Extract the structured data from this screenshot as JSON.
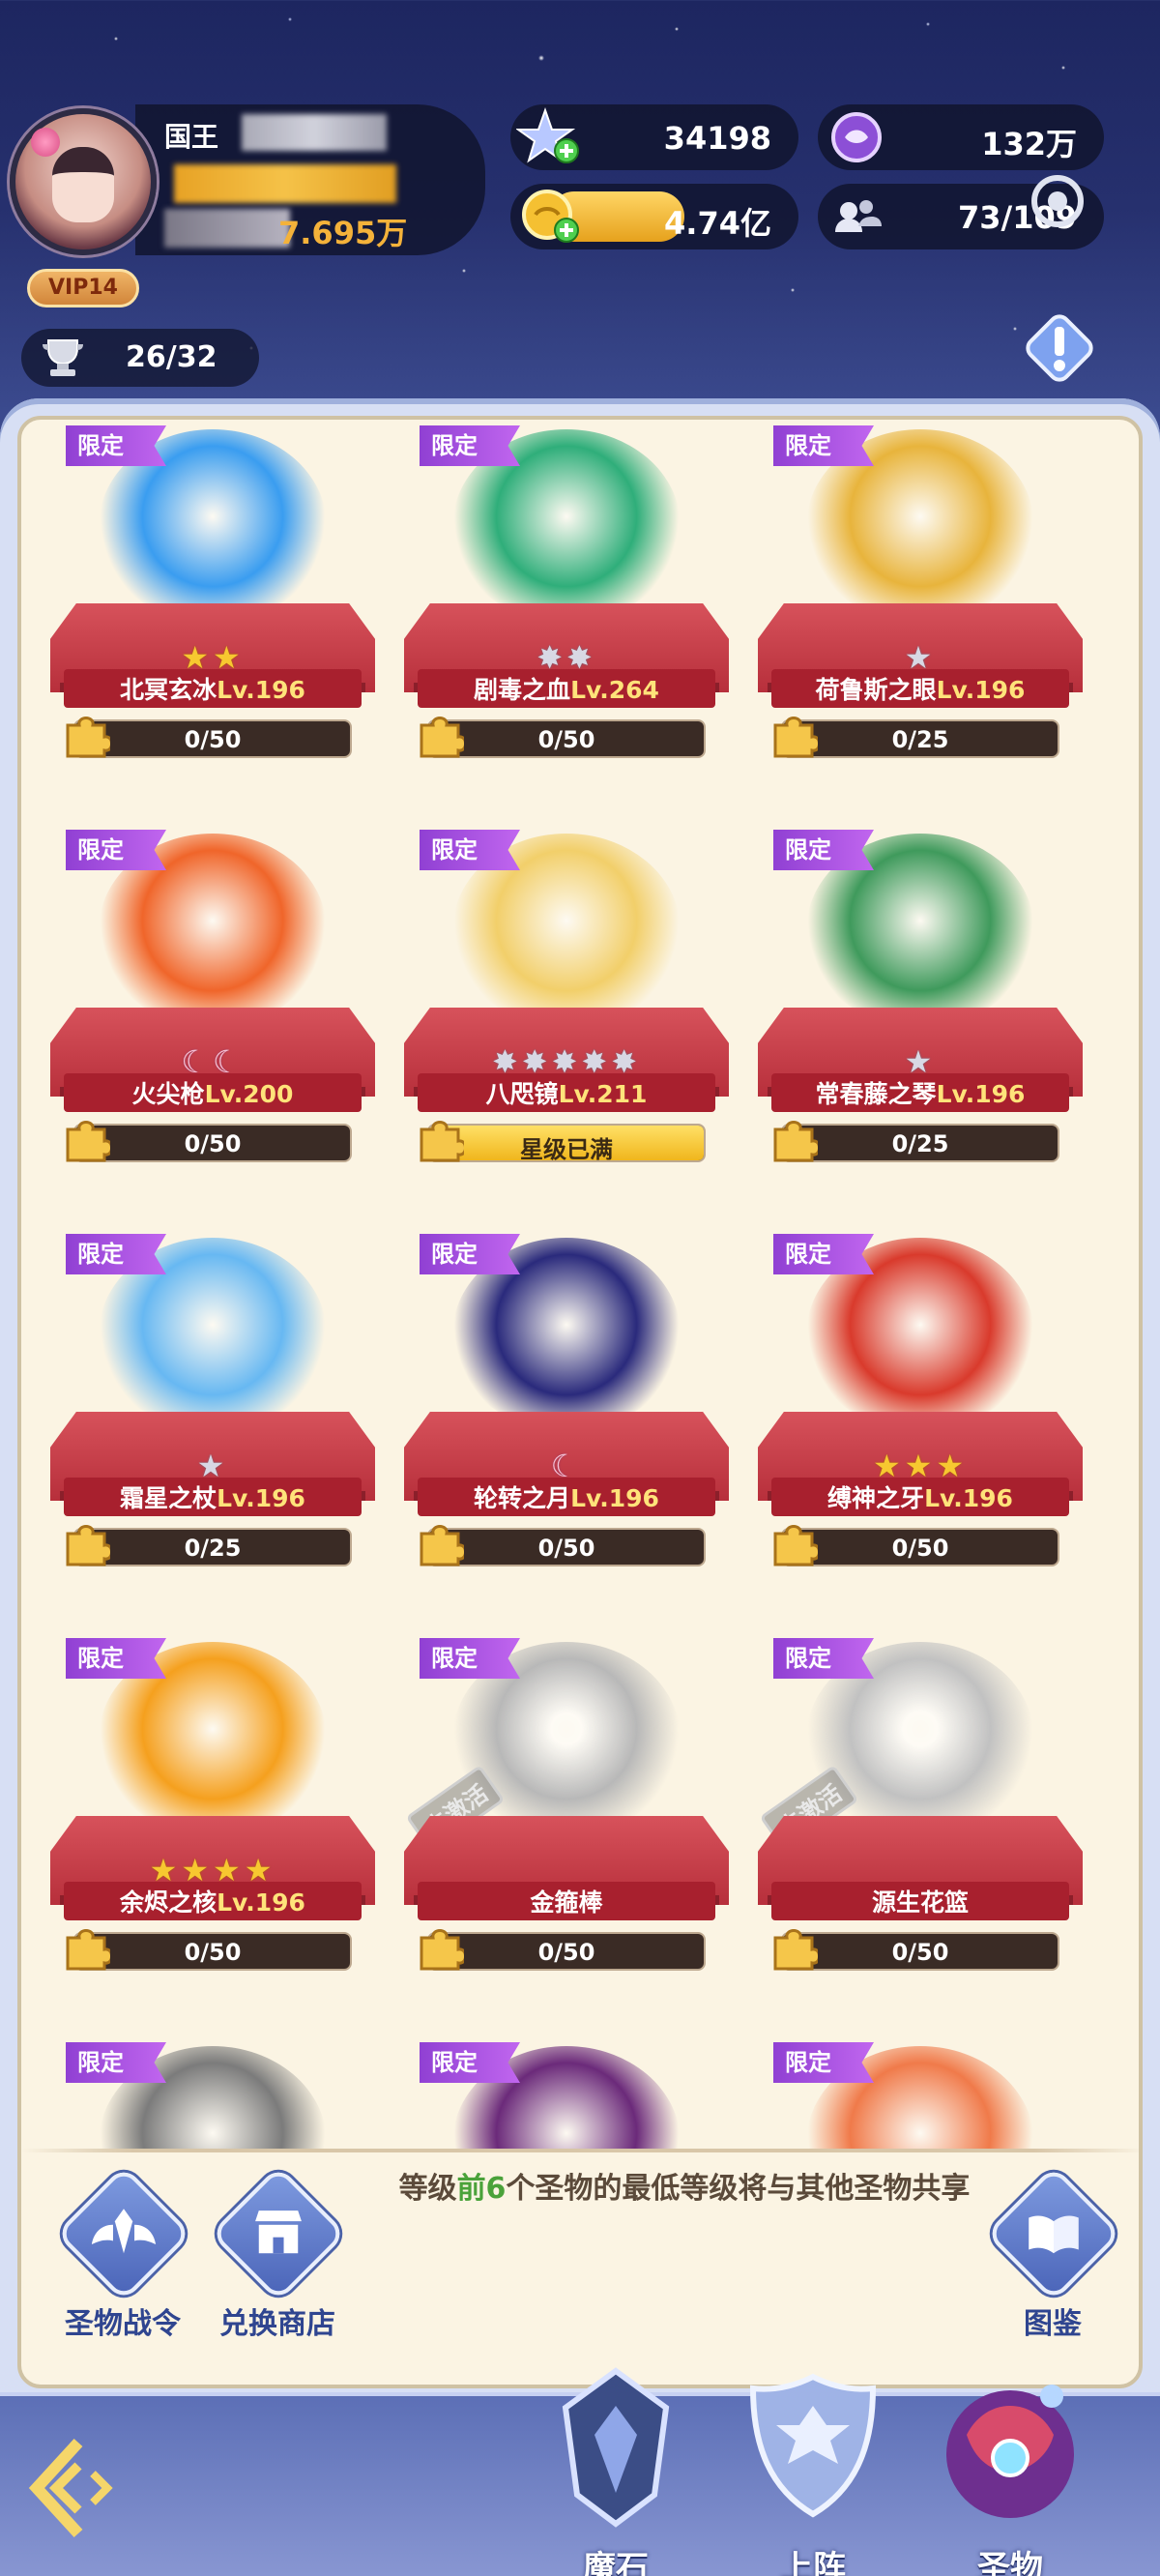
{
  "header": {
    "player_name": "国王",
    "power": "7.695万",
    "vip": "VIP14",
    "collection": "26/32",
    "resources": {
      "crystal": "34198",
      "purple_currency": "132万",
      "gold": "4.74亿",
      "guild": "73/109"
    }
  },
  "cards": [
    {
      "tag": "限定",
      "name": "北冥玄冰",
      "level": "Lv.196",
      "stars": "★★",
      "star_type": "gold",
      "progress": "0/50",
      "progress_value": 0.0,
      "color": "#3a9df0"
    },
    {
      "tag": "限定",
      "name": "剧毒之血",
      "level": "Lv.264",
      "stars": "✸✸",
      "star_type": "silver",
      "progress": "0/50",
      "progress_value": 0.0,
      "color": "#2fae7a"
    },
    {
      "tag": "限定",
      "name": "荷鲁斯之眼",
      "level": "Lv.196",
      "stars": "★",
      "star_type": "silver",
      "progress": "0/25",
      "progress_value": 0.0,
      "color": "#e8b43c"
    },
    {
      "tag": "限定",
      "name": "火尖枪",
      "level": "Lv.200",
      "stars": "☾☾",
      "star_type": "moon",
      "progress": "0/50",
      "progress_value": 0.0,
      "color": "#f0652a"
    },
    {
      "tag": "限定",
      "name": "八咫镜",
      "level": "Lv.211",
      "stars": "✸✸✸✸✸",
      "star_type": "silver",
      "progress": "星级已满",
      "progress_value": 1.0,
      "color": "#f2cf6a"
    },
    {
      "tag": "限定",
      "name": "常春藤之琴",
      "level": "Lv.196",
      "stars": "★",
      "star_type": "silver",
      "progress": "0/25",
      "progress_value": 0.0,
      "color": "#3f9a5c"
    },
    {
      "tag": "限定",
      "name": "霜星之杖",
      "level": "Lv.196",
      "stars": "★",
      "star_type": "silver",
      "progress": "0/25",
      "progress_value": 0.0,
      "color": "#67b8f2"
    },
    {
      "tag": "限定",
      "name": "轮转之月",
      "level": "Lv.196",
      "stars": "☾",
      "star_type": "moon",
      "progress": "0/50",
      "progress_value": 0.0,
      "color": "#2a2a7c"
    },
    {
      "tag": "限定",
      "name": "缚神之牙",
      "level": "Lv.196",
      "stars": "★★★",
      "star_type": "gold",
      "progress": "0/50",
      "progress_value": 0.0,
      "color": "#d93a2c"
    },
    {
      "tag": "限定",
      "name": "余烬之核",
      "level": "Lv.196",
      "stars": "★★★★",
      "star_type": "gold",
      "progress": "0/50",
      "progress_value": 0.0,
      "color": "#f5a01e"
    },
    {
      "tag": "限定",
      "name": "金箍棒",
      "level": "",
      "stars": "",
      "star_type": "gold",
      "progress": "0/50",
      "progress_value": 0.0,
      "color": "#a0a0a0",
      "inactive": "未激活"
    },
    {
      "tag": "限定",
      "name": "源生花篮",
      "level": "",
      "stars": "",
      "star_type": "gold",
      "progress": "0/50",
      "progress_value": 0.0,
      "color": "#a8a8a8",
      "inactive": "未激活"
    },
    {
      "tag": "限定",
      "name": "",
      "level": "",
      "stars": "",
      "star_type": "gold",
      "progress": "",
      "progress_value": 0.0,
      "color": "#7b7b7b"
    },
    {
      "tag": "限定",
      "name": "",
      "level": "",
      "stars": "",
      "star_type": "gold",
      "progress": "",
      "progress_value": 0.0,
      "color": "#6b2a7a"
    },
    {
      "tag": "限定",
      "name": "",
      "level": "",
      "stars": "",
      "star_type": "gold",
      "progress": "",
      "progress_value": 0.0,
      "color": "#f07a4a"
    }
  ],
  "footer": {
    "battle_pass": "圣物战令",
    "exchange_shop": "兑换商店",
    "tip_prefix": "等级",
    "tip_highlight": "前6",
    "tip_suffix": "个圣物的最低等级将与其他圣物共享",
    "codex": "图鉴"
  },
  "nav": {
    "tab1": "魔石",
    "tab2": "上阵",
    "tab3": "圣物"
  }
}
